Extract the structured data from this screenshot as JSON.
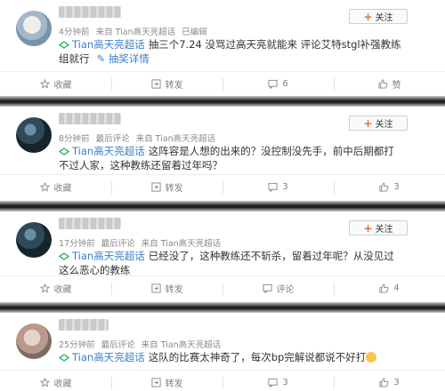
{
  "posts": [
    {
      "time": "4分钟前",
      "comment_source": "",
      "source": "来自 Tian高天亮超话",
      "status": "已编辑",
      "follow_label": "关注",
      "topic": "Tian高天亮超话",
      "text": "抽三个7.24 没骂过高天亮就能来 评论艾特stgl补强教练组就行",
      "lottery_label": "抽奖详情",
      "actions": {
        "fav": "收藏",
        "repost": "转发",
        "comment": "6",
        "like": "赞"
      }
    },
    {
      "time": "8分钟前",
      "comment_source": "最后评论",
      "source": "来自 Tian高天亮超话",
      "status": "",
      "follow_label": "关注",
      "topic": "Tian高天亮超话",
      "text": "这阵容是人想的出来的？没控制没先手，前中后期都打不过人家，这种教练还留着过年吗？",
      "actions": {
        "fav": "收藏",
        "repost": "转发",
        "comment": "3",
        "like": "3"
      }
    },
    {
      "time": "17分钟前",
      "comment_source": "最后评论",
      "source": "来自 Tian高天亮超话",
      "status": "",
      "follow_label": "关注",
      "topic": "Tian高天亮超话",
      "text": "已经没了，这种教练还不斩杀，留着过年呢？从没见过这么恶心的教练",
      "actions": {
        "fav": "收藏",
        "repost": "转发",
        "comment": "评论",
        "like": "4"
      }
    },
    {
      "time": "25分钟前",
      "comment_source": "最后评论",
      "source": "来自 Tian高天亮超话",
      "status": "",
      "topic": "Tian高天亮超话",
      "text": "这队的比赛太神奇了，每次bp完解说都说不好打",
      "actions": {
        "fav": "收藏",
        "repost": "转发",
        "comment": "3",
        "like": "3"
      }
    }
  ],
  "colors": {
    "link": "#3a7fc9",
    "accent": "#f36a2b",
    "meta": "#8a8a8a"
  },
  "icons": {
    "fav": "star-icon",
    "repost": "repost-icon",
    "comment": "comment-icon",
    "like": "thumbs-up-icon",
    "topic": "super-topic-icon"
  }
}
